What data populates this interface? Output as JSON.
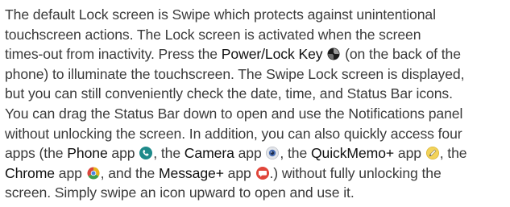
{
  "lines": {
    "l1": "The default Lock screen is Swipe which protects against unintentional",
    "l2": "touchscreen actions. The Lock screen is activated when the screen",
    "l3a": "times-out from inactivity. Press the ",
    "l3b": "Power/Lock Key",
    "l3c": " (on the back of the",
    "l4": "phone) to illuminate the touchscreen. The Swipe Lock screen is displayed,",
    "l5": "but you can still conveniently check the date, time, and Status Bar icons.",
    "l6": "You can drag the Status Bar down to open and use the Notifications panel",
    "l7": "without unlocking the screen. In addition, you can also quickly access four",
    "l8a": "apps (the ",
    "l8b": "Phone",
    "l8c": " app ",
    "l8d": ", the ",
    "l8e": "Camera",
    "l8f": " app ",
    "l8g": ", the ",
    "l8h": "QuickMemo+",
    "l8i": " app ",
    "l8j": ", the",
    "l9a": "Chrome",
    "l9b": " app ",
    "l9c": ", and the ",
    "l9d": "Message+",
    "l9e": " app ",
    "l9f": ".) without fully unlocking the",
    "l10": "screen. Simply swipe an icon upward to open and use it."
  },
  "icons": {
    "power": "power-lock-key-icon",
    "phone": "phone-app-icon",
    "camera": "camera-app-icon",
    "quickmemo": "quickmemo-app-icon",
    "chrome": "chrome-app-icon",
    "message": "message-app-icon"
  },
  "colors": {
    "text": "#3a3a3a",
    "bold_text": "#111111",
    "phone": "#1e8a8a",
    "camera": "#4a6fb5",
    "quickmemo": "#e0b020",
    "message": "#e0453a"
  }
}
